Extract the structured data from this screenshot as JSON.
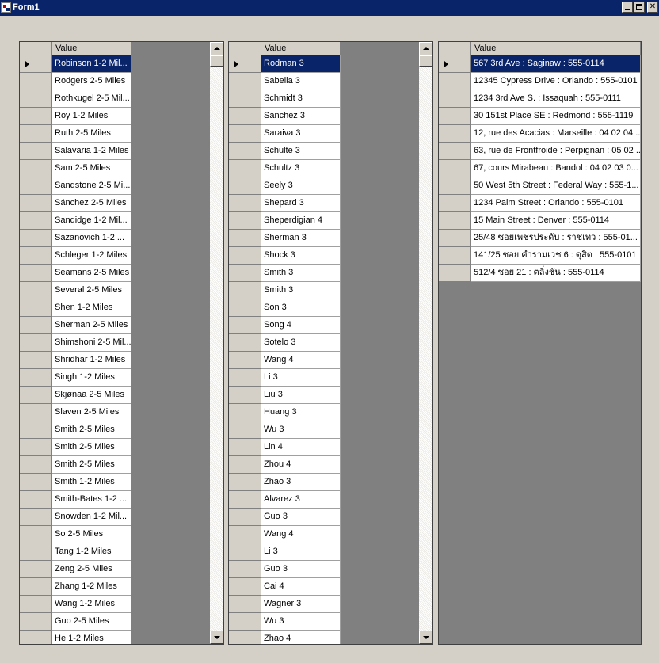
{
  "window": {
    "title": "Form1"
  },
  "grid1": {
    "column": "Value",
    "rows": [
      "Robinson 1-2 Mil...",
      "Rodgers 2-5 Miles",
      "Rothkugel 2-5 Mil...",
      "Roy 1-2 Miles",
      "Ruth 2-5 Miles",
      "Salavaria 1-2 Miles",
      "Sam 2-5 Miles",
      "Sandstone 2-5 Mi...",
      "Sánchez 2-5 Miles",
      "Sandidge 1-2 Mil...",
      "Sazanovich 1-2 ...",
      "Schleger 1-2 Miles",
      "Seamans 2-5 Miles",
      "Several 2-5 Miles",
      "Shen 1-2 Miles",
      "Sherman 2-5 Miles",
      "Shimshoni 2-5 Mil...",
      "Shridhar 1-2 Miles",
      "Singh 1-2 Miles",
      "Skjønaa 2-5 Miles",
      "Slaven 2-5 Miles",
      "Smith 2-5 Miles",
      "Smith 2-5 Miles",
      "Smith 2-5 Miles",
      "Smith 1-2 Miles",
      "Smith-Bates 1-2 ...",
      "Snowden 1-2 Mil...",
      "So 2-5 Miles",
      "Tang 1-2 Miles",
      "Zeng 2-5 Miles",
      "Zhang 1-2 Miles",
      "Wang 1-2 Miles",
      "Guo 2-5 Miles",
      "He 1-2 Miles"
    ]
  },
  "grid2": {
    "column": "Value",
    "rows": [
      "Rodman 3",
      "Sabella 3",
      "Schmidt 3",
      "Sanchez 3",
      "Saraiva 3",
      "Schulte 3",
      "Schultz 3",
      "Seely 3",
      "Shepard 3",
      "Sheperdigian 4",
      "Sherman 3",
      "Shock 3",
      "Smith 3",
      "Smith 3",
      "Son 3",
      "Song 4",
      "Sotelo 3",
      "Wang 4",
      "Li 3",
      "Liu 3",
      "Huang 3",
      "Wu 3",
      "Lin 4",
      "Zhou 4",
      "Zhao 3",
      "Alvarez 3",
      "Guo 3",
      "Wang 4",
      "Li 3",
      "Guo 3",
      "Cai 4",
      "Wagner 3",
      "Wu 3",
      "Zhao 4"
    ]
  },
  "grid3": {
    "column": "Value",
    "rows": [
      "567 3rd Ave : Saginaw : 555-0114",
      "12345 Cypress Drive : Orlando : 555-0101",
      "1234 3rd Ave S. : Issaquah : 555-0111",
      "30 151st Place SE : Redmond : 555-1119",
      "12, rue des Acacias : Marseille : 04 02 04 ...",
      "63, rue de Frontfroide : Perpignan : 05 02 ...",
      "67, cours Mirabeau : Bandol : 04 02 03 0...",
      "50 West 5th Street : Federal Way : 555-1...",
      "1234 Palm Street : Orlando : 555-0101",
      "15 Main Street : Denver : 555-0114",
      "25/48 ซอยเพชรประดับ : ราชเทว : 555-01...",
      "141/25 ซอย คำรามเวช 6 : ดุสิต  : 555-0101",
      "512/4 ซอย 21 : ตลิ่งชัน  : 555-0114"
    ]
  },
  "colors": {
    "titlebar": "#0a246a",
    "selection": "#0a246a",
    "window_bg": "#d4d0c8",
    "grid_bg": "#808080"
  }
}
